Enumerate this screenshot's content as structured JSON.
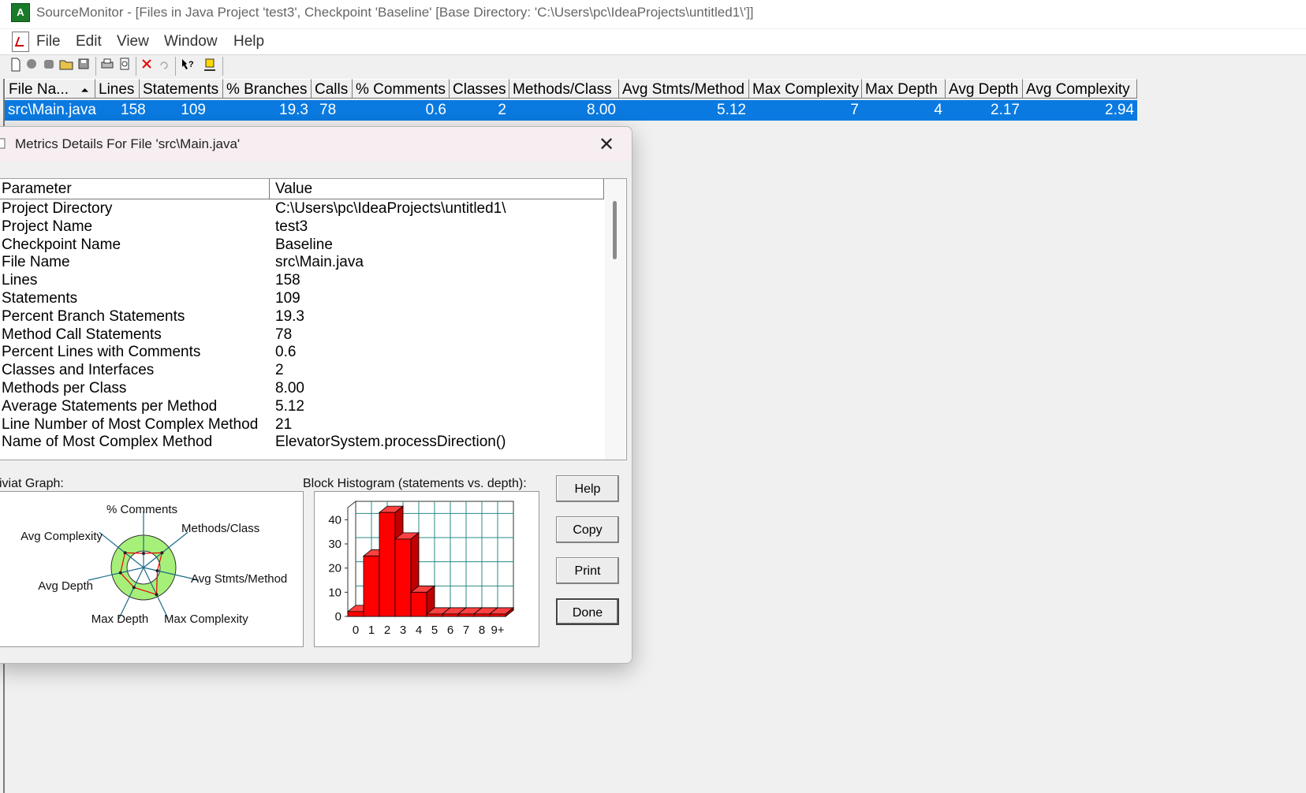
{
  "window": {
    "title": "SourceMonitor - [Files in Java Project 'test3', Checkpoint 'Baseline'  [Base Directory: 'C:\\Users\\pc\\IdeaProjects\\untitled1\\']]"
  },
  "menubar": {
    "items": [
      "File",
      "Edit",
      "View",
      "Window",
      "Help"
    ]
  },
  "table": {
    "columns": [
      "File Na...",
      "Lines",
      "Statements",
      "% Branches",
      "Calls",
      "% Comments",
      "Classes",
      "Methods/Class",
      "Avg Stmts/Method",
      "Max Complexity",
      "Max Depth",
      "Avg Depth",
      "Avg Complexity"
    ],
    "sort_indicator": "⏶",
    "rows": [
      [
        "src\\Main.java",
        "158",
        "109",
        "19.3",
        "78",
        "0.6",
        "2",
        "8.00",
        "5.12",
        "7",
        "4",
        "2.17",
        "2.94"
      ]
    ]
  },
  "dialog": {
    "title": "Metrics Details For File 'src\\Main.java'",
    "list_headers": [
      "Parameter",
      "Value"
    ],
    "params": [
      [
        "Project Directory",
        "C:\\Users\\pc\\IdeaProjects\\untitled1\\"
      ],
      [
        "Project Name",
        "test3"
      ],
      [
        "Checkpoint Name",
        "Baseline"
      ],
      [
        "File Name",
        "src\\Main.java"
      ],
      [
        "Lines",
        "158"
      ],
      [
        "Statements",
        "109"
      ],
      [
        "Percent Branch Statements",
        "19.3"
      ],
      [
        "Method Call Statements",
        "78"
      ],
      [
        "Percent Lines with Comments",
        "0.6"
      ],
      [
        "Classes and Interfaces",
        "2"
      ],
      [
        "Methods per Class",
        "8.00"
      ],
      [
        "Average Statements per Method",
        "5.12"
      ],
      [
        "Line Number of Most Complex Method",
        "21"
      ],
      [
        "Name of Most Complex Method",
        "ElevatorSystem.processDirection()"
      ]
    ],
    "kiviat_caption": "iviat Graph:",
    "histogram_caption": "Block Histogram (statements vs. depth):",
    "buttons": {
      "help": "Help",
      "copy": "Copy",
      "print": "Print",
      "done": "Done"
    },
    "close_glyph": "✕"
  },
  "chart_data": [
    {
      "type": "radar",
      "title": "iviat Graph:",
      "axes": [
        "% Comments",
        "Methods/Class",
        "Avg Stmts/Method",
        "Max Complexity",
        "Max Depth",
        "Avg Depth",
        "Avg Complexity"
      ],
      "ring_color": "#a6f07a"
    },
    {
      "type": "bar",
      "title": "Block Histogram (statements vs. depth):",
      "categories": [
        "0",
        "1",
        "2",
        "3",
        "4",
        "5",
        "6",
        "7",
        "8",
        "9+"
      ],
      "values": [
        2,
        25,
        43,
        32,
        10,
        1,
        1,
        1,
        1,
        1
      ],
      "ylim": [
        0,
        45
      ],
      "yticks": [
        0,
        10,
        20,
        30,
        40
      ],
      "bar_color": "#ff0000",
      "grid": true
    }
  ]
}
